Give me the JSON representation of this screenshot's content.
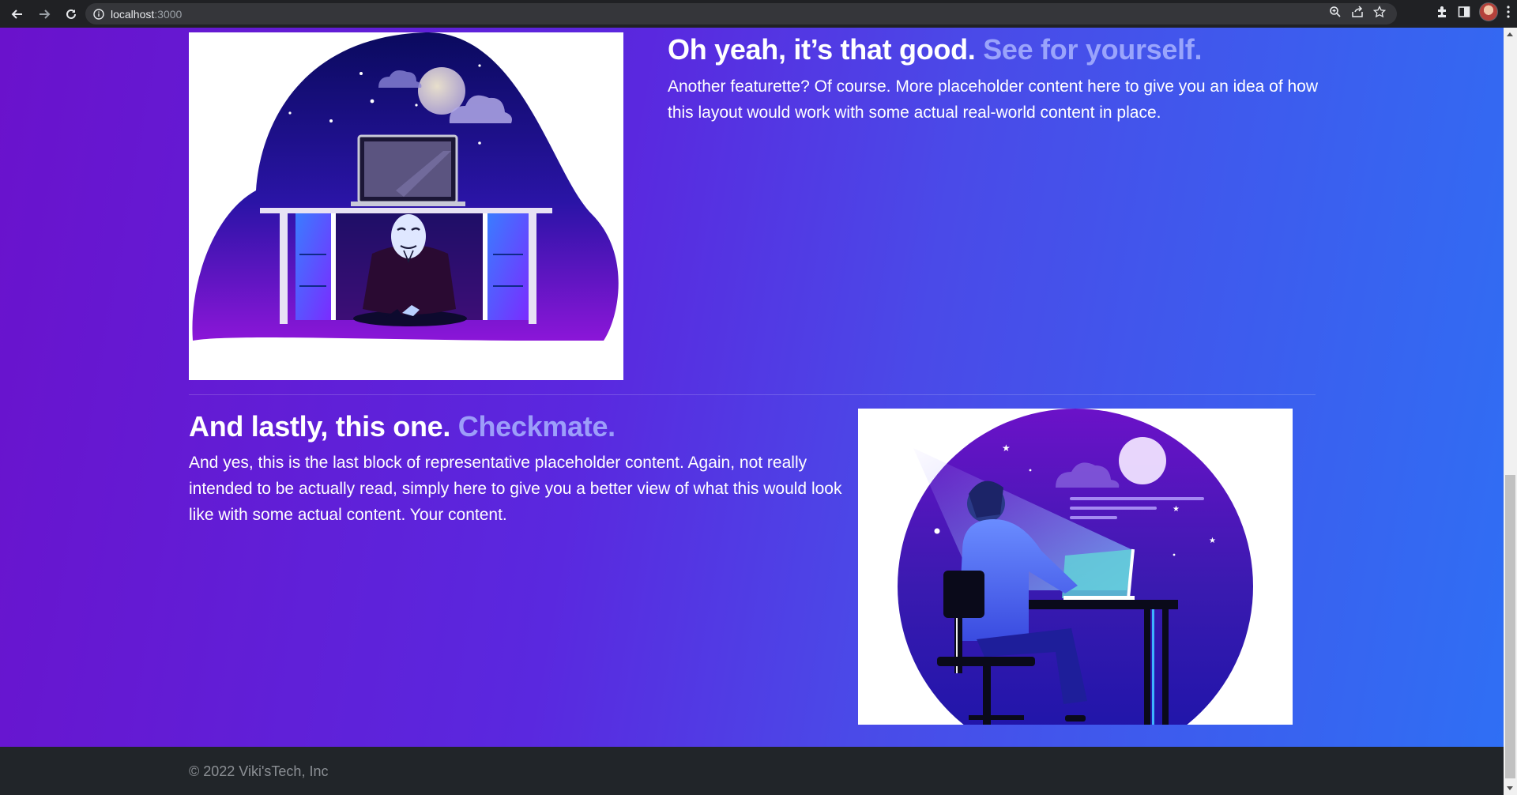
{
  "browser": {
    "url_host": "localhost",
    "url_port": ":3000",
    "icons": [
      "back-icon",
      "forward-icon",
      "reload-icon",
      "site-info-icon",
      "zoom-icon",
      "share-icon",
      "bookmark-star-icon",
      "extensions-icon",
      "side-panel-icon",
      "profile-avatar",
      "menu-kebab-icon"
    ]
  },
  "features": [
    {
      "heading": "Oh yeah, it’s that good.",
      "heading_muted": "See for yourself.",
      "text": "Another featurette? Of course. More placeholder content here to give you an idea of how this layout would work with some actual real-world content in place."
    },
    {
      "heading": "And lastly, this one.",
      "heading_muted": "Checkmate.",
      "text": "And yes, this is the last block of representative placeholder content. Again, not really intended to be actually read, simply here to give you a better view of what this would look like with some actual content. Your content."
    }
  ],
  "footer": {
    "copyright": "© 2022 Viki'sTech, Inc"
  },
  "colors": {
    "gradient_start": "#6a12cc",
    "gradient_end": "#2f6ff4",
    "muted_heading": "#a9b3ff",
    "footer_bg": "#212529"
  }
}
